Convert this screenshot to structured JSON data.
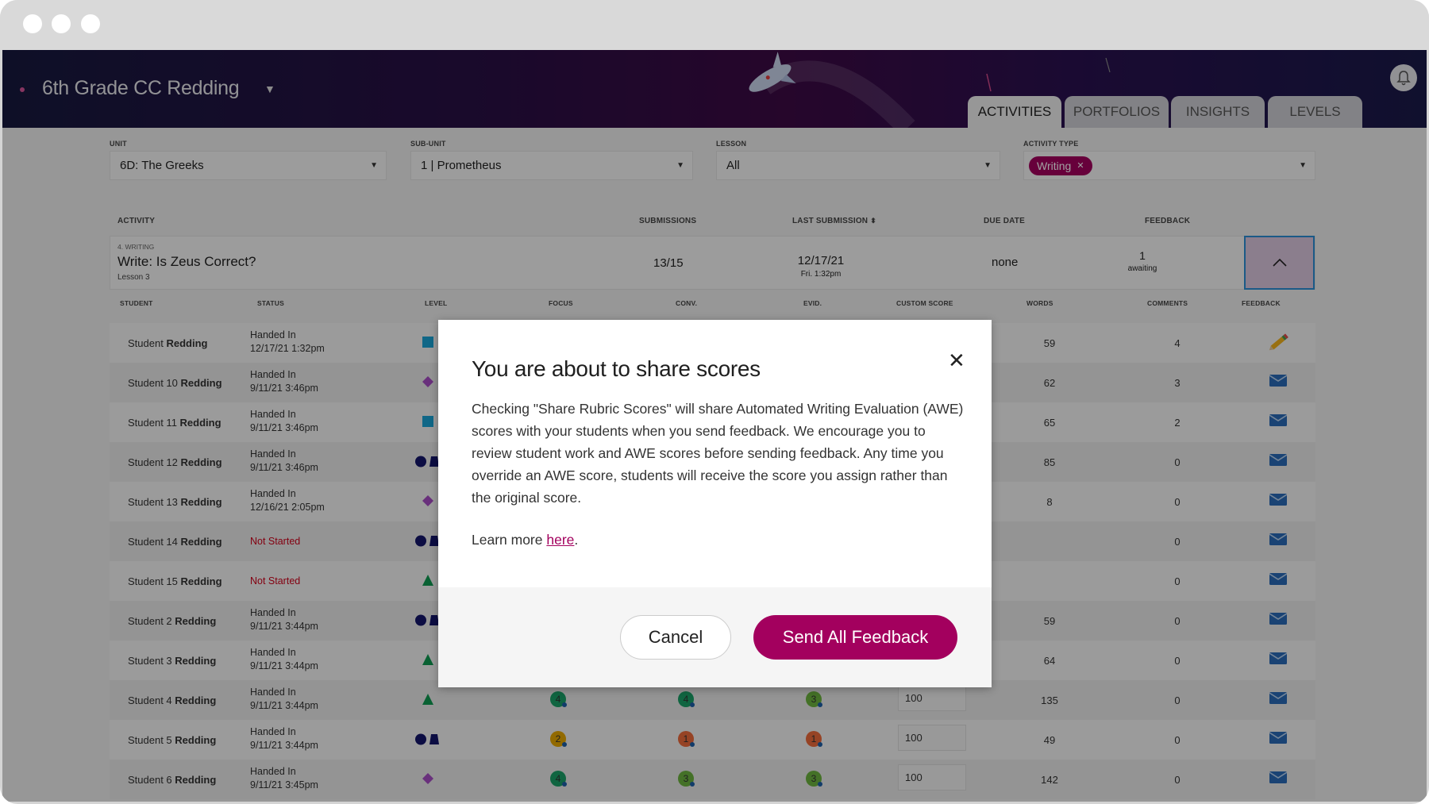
{
  "header": {
    "class_title": "6th Grade CC Redding",
    "tabs": [
      {
        "label": "ACTIVITIES",
        "active": true
      },
      {
        "label": "PORTFOLIOS",
        "active": false
      },
      {
        "label": "INSIGHTS",
        "active": false
      },
      {
        "label": "LEVELS",
        "active": false
      }
    ]
  },
  "filters": {
    "unit": {
      "label": "UNIT",
      "value": "6D: The Greeks"
    },
    "subunit": {
      "label": "SUB-UNIT",
      "value": "1 | Prometheus"
    },
    "lesson": {
      "label": "LESSON",
      "value": "All"
    },
    "activity_type": {
      "label": "ACTIVITY TYPE",
      "chip": "Writing",
      "chip_remove": "✕"
    }
  },
  "activity_table": {
    "columns": [
      "ACTIVITY",
      "SUBMISSIONS",
      "LAST SUBMISSION",
      "DUE DATE",
      "FEEDBACK"
    ],
    "row": {
      "type": "4. WRITING",
      "title": "Write: Is Zeus Correct?",
      "lesson": "Lesson 3",
      "submissions": "13/15",
      "last_submission_date": "12/17/21",
      "last_submission_time": "Fri. 1:32pm",
      "due_date": "none",
      "feedback_count": "1",
      "feedback_label": "awaiting"
    }
  },
  "student_table": {
    "columns": [
      "STUDENT",
      "STATUS",
      "LEVEL",
      "FOCUS",
      "CONV.",
      "EVID.",
      "CUSTOM SCORE",
      "WORDS",
      "COMMENTS",
      "FEEDBACK"
    ],
    "rows": [
      {
        "first": "Student",
        "last": "Redding",
        "status": "Handed In",
        "date": "12/17/21 1:32pm",
        "level": "square",
        "words": "59",
        "comments": "4",
        "feedback_icon": "pencil"
      },
      {
        "first": "Student 10",
        "last": "Redding",
        "status": "Handed In",
        "date": "9/11/21 3:46pm",
        "level": "diamond",
        "words": "62",
        "comments": "3",
        "feedback_icon": "mail"
      },
      {
        "first": "Student 11",
        "last": "Redding",
        "status": "Handed In",
        "date": "9/11/21 3:46pm",
        "level": "square",
        "words": "65",
        "comments": "2",
        "feedback_icon": "mail"
      },
      {
        "first": "Student 12",
        "last": "Redding",
        "status": "Handed In",
        "date": "9/11/21 3:46pm",
        "level": "circle-trapezoid",
        "words": "85",
        "comments": "0",
        "feedback_icon": "mail"
      },
      {
        "first": "Student 13",
        "last": "Redding",
        "status": "Handed In",
        "date": "12/16/21 2:05pm",
        "level": "diamond",
        "words": "8",
        "comments": "0",
        "feedback_icon": "mail"
      },
      {
        "first": "Student 14",
        "last": "Redding",
        "status": "Not Started",
        "date": "",
        "level": "circle-trapezoid",
        "words": "",
        "comments": "0",
        "feedback_icon": "mail"
      },
      {
        "first": "Student 15",
        "last": "Redding",
        "status": "Not Started",
        "date": "",
        "level": "triangle",
        "words": "",
        "comments": "0",
        "feedback_icon": "mail"
      },
      {
        "first": "Student 2",
        "last": "Redding",
        "status": "Handed In",
        "date": "9/11/21 3:44pm",
        "level": "circle-trapezoid",
        "words": "59",
        "comments": "0",
        "feedback_icon": "mail"
      },
      {
        "first": "Student 3",
        "last": "Redding",
        "status": "Handed In",
        "date": "9/11/21 3:44pm",
        "level": "triangle",
        "words": "64",
        "comments": "0",
        "feedback_icon": "mail"
      },
      {
        "first": "Student 4",
        "last": "Redding",
        "status": "Handed In",
        "date": "9/11/21 3:44pm",
        "level": "triangle",
        "focus": "4",
        "conv": "4",
        "evid": "3",
        "custom_score": "100",
        "words": "135",
        "comments": "0",
        "feedback_icon": "mail"
      },
      {
        "first": "Student 5",
        "last": "Redding",
        "status": "Handed In",
        "date": "9/11/21 3:44pm",
        "level": "circle-trapezoid",
        "focus": "2",
        "conv": "1",
        "evid": "1",
        "custom_score": "100",
        "words": "49",
        "comments": "0",
        "feedback_icon": "mail"
      },
      {
        "first": "Student 6",
        "last": "Redding",
        "status": "Handed In",
        "date": "9/11/21 3:45pm",
        "level": "diamond",
        "focus": "4",
        "conv": "3",
        "evid": "3",
        "custom_score": "100",
        "words": "142",
        "comments": "0",
        "feedback_icon": "mail"
      }
    ]
  },
  "modal": {
    "title": "You are about to share scores",
    "body": "Checking \"Share Rubric Scores\" will share Automated Writing Evaluation (AWE) scores with your students when you send feedback. We encourage you to review student work and AWE scores before sending feedback. Any time you override an AWE score, students will receive the score you assign rather than the original score.",
    "learn_prefix": "Learn more ",
    "learn_link": "here",
    "learn_suffix": ".",
    "close": "✕",
    "cancel_label": "Cancel",
    "send_label": "Send All Feedback"
  },
  "colors": {
    "accent": "#a3005e",
    "not_started": "#d0021b",
    "score_4": "#1aa067",
    "score_3": "#6db33f",
    "score_2": "#e8a800",
    "score_1": "#ee6a3c",
    "level_square": "#1aa3d6",
    "level_diamond": "#a64dc4",
    "level_triangle": "#0f9a52",
    "level_circle": "#14166a"
  }
}
